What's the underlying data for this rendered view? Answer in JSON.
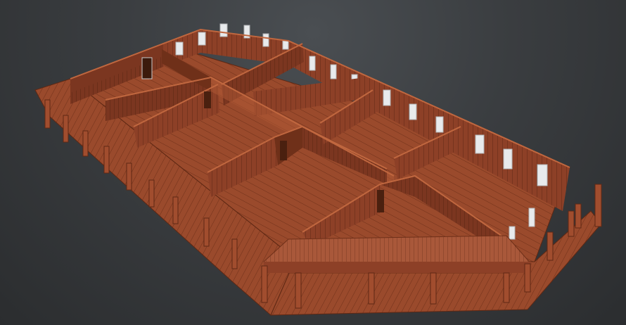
{
  "scene": {
    "subject": "3d-wooden-building-model",
    "colors": {
      "background_top": "#4a4e52",
      "background_bottom": "#2b2d2f",
      "wood_floor": "#9a4a2c",
      "wood_floor_dark": "#7e3a22",
      "wood_wall_inner": "#8d4027",
      "wood_wall_dark": "#6f3019",
      "wood_wall_top": "#b25a36",
      "window_glass": "#e8eaec",
      "window_frame": "#c9cbcd"
    }
  }
}
